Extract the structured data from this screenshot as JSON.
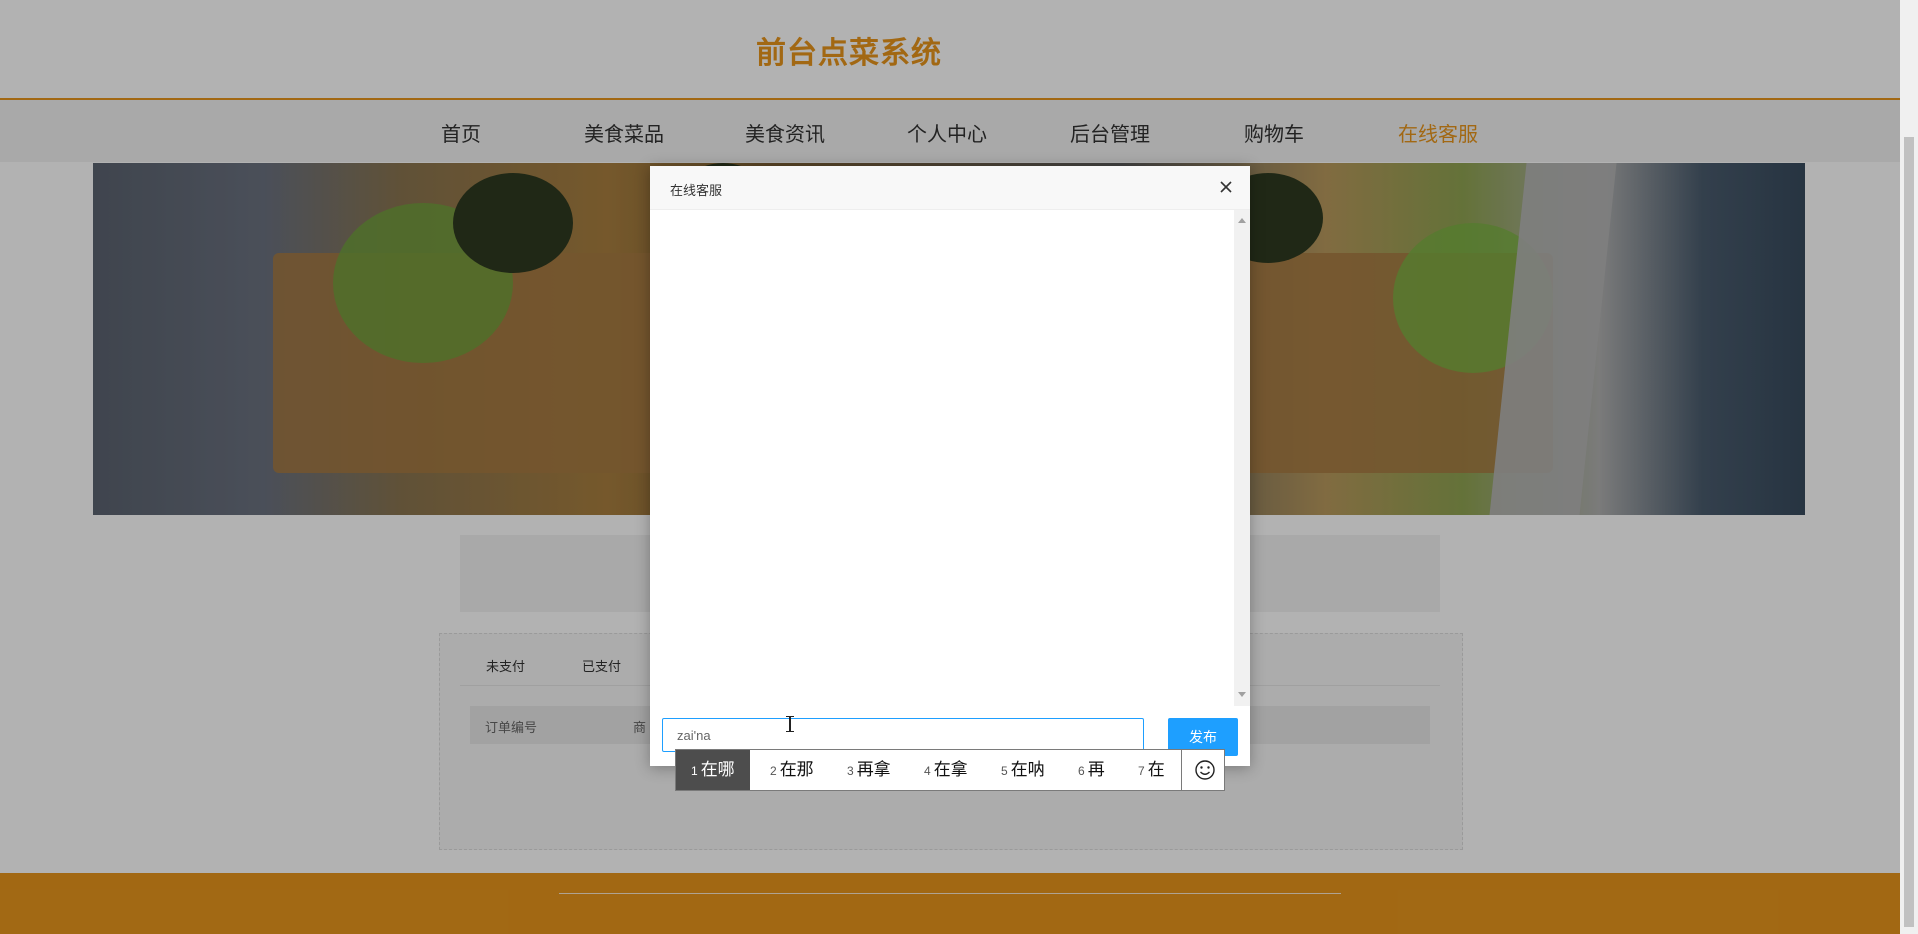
{
  "header": {
    "site_title": "前台点菜系统"
  },
  "nav": {
    "items": [
      {
        "label": "首页"
      },
      {
        "label": "美食菜品"
      },
      {
        "label": "美食资讯"
      },
      {
        "label": "个人中心"
      },
      {
        "label": "后台管理"
      },
      {
        "label": "购物车"
      },
      {
        "label": "在线客服",
        "active": true
      }
    ]
  },
  "orders": {
    "tabs": [
      "未支付",
      "已支付"
    ],
    "columns": [
      "订单编号",
      "商"
    ]
  },
  "dialog": {
    "title": "在线客服",
    "input_value": "zai'na",
    "send_label": "发布"
  },
  "ime": {
    "candidates": [
      {
        "num": "1",
        "text": "在哪",
        "selected": true
      },
      {
        "num": "2",
        "text": "在那"
      },
      {
        "num": "3",
        "text": "再拿"
      },
      {
        "num": "4",
        "text": "在拿"
      },
      {
        "num": "5",
        "text": "在呐"
      },
      {
        "num": "6",
        "text": "再"
      },
      {
        "num": "7",
        "text": "在"
      }
    ]
  },
  "colors": {
    "accent": "#e8961c",
    "primary_button": "#1e9fff"
  }
}
